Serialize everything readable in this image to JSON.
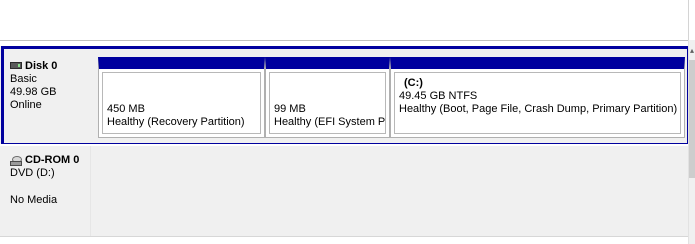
{
  "disks": [
    {
      "name": "Disk 0",
      "type": "Basic",
      "size": "49.98 GB",
      "status": "Online",
      "icon": "hard-disk-icon",
      "partitions": [
        {
          "drive_letter": "",
          "size": "450 MB",
          "status": "Healthy (Recovery Partition)"
        },
        {
          "drive_letter": "",
          "size": "99 MB",
          "status": "Healthy (EFI System Partition)"
        },
        {
          "drive_letter": "(C:)",
          "size": "49.45 GB NTFS",
          "status": "Healthy (Boot, Page File, Crash Dump, Primary Partition)"
        }
      ]
    },
    {
      "name": "CD-ROM 0",
      "type": "DVD (D:)",
      "media": "No Media",
      "icon": "cd-rom-icon"
    }
  ],
  "colors": {
    "selection_border": "#00009e",
    "partition_header": "#00009e",
    "background": "#f0f0f0"
  }
}
